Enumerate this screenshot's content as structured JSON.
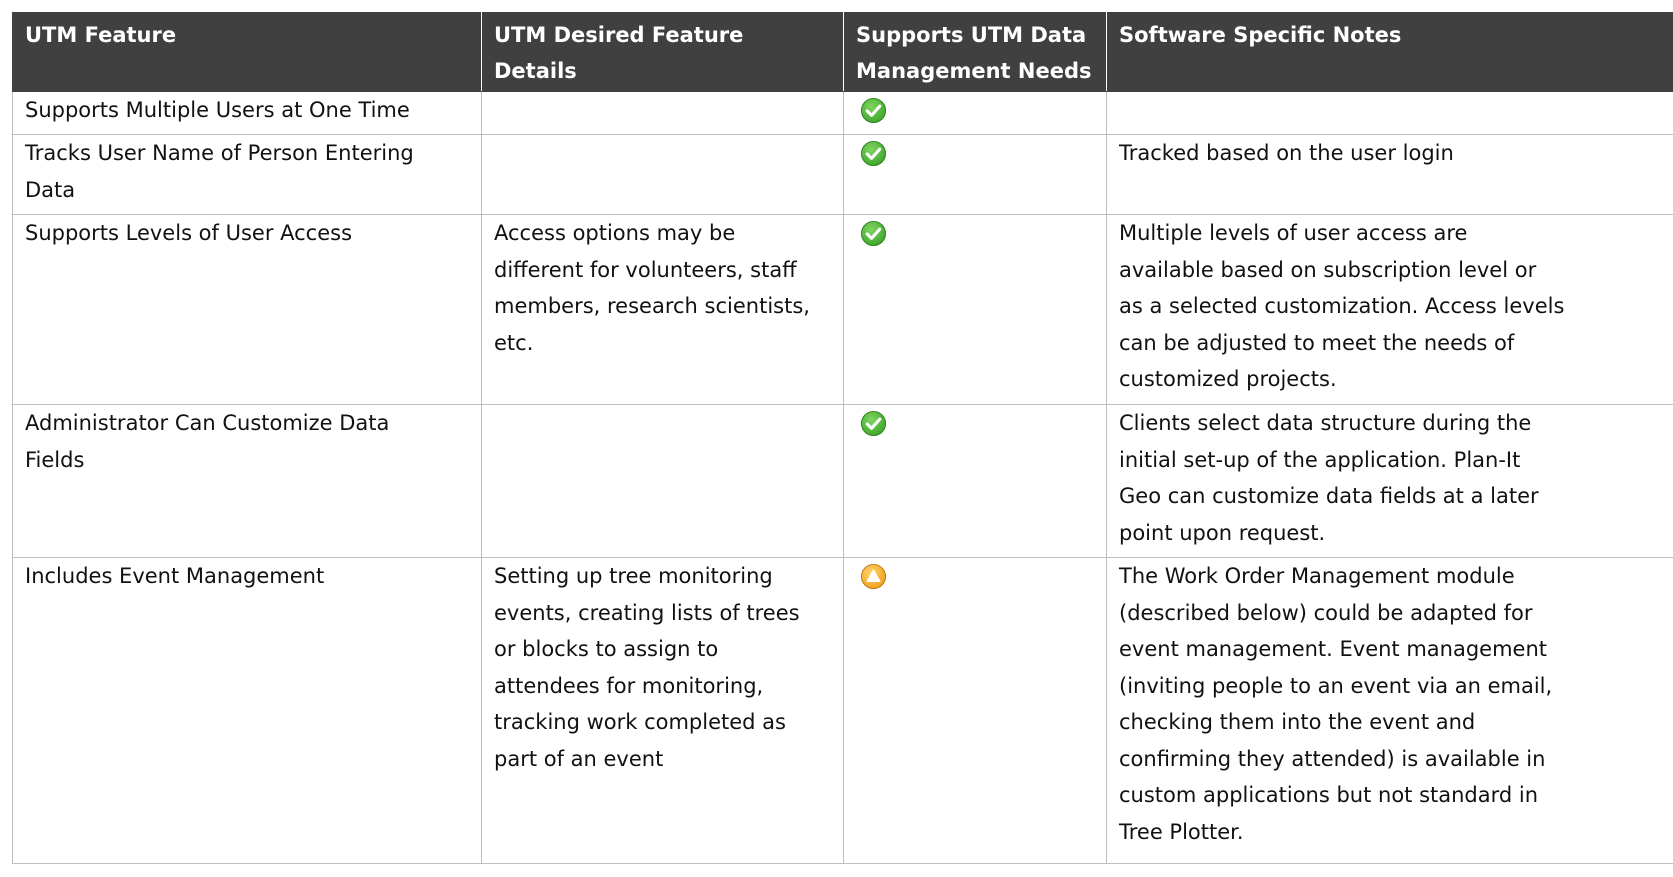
{
  "header": {
    "col1": [
      "UTM Feature"
    ],
    "col2": [
      "UTM Desired Feature Details"
    ],
    "col3": [
      "Supports UTM Data",
      "Management Needs"
    ],
    "col4": [
      "Software Specific Notes"
    ]
  },
  "rows": [
    {
      "feature": [
        "Supports Multiple Users at One Time"
      ],
      "details": [],
      "status": "supported",
      "notes": []
    },
    {
      "feature": [
        "Tracks User Name of Person Entering",
        "Data"
      ],
      "details": [],
      "status": "supported",
      "notes": [
        "Tracked based on the user login"
      ]
    },
    {
      "feature": [
        "Supports Levels of User Access"
      ],
      "details": [
        "Access options may be",
        "different for volunteers, staff",
        "members, research scientists,",
        "etc."
      ],
      "status": "supported",
      "notes": [
        "Multiple levels of user access are",
        "available based on subscription level or",
        "as a selected customization. Access levels",
        "can be adjusted to meet the needs of",
        "customized projects."
      ]
    },
    {
      "feature": [
        "Administrator Can Customize Data",
        "Fields"
      ],
      "details": [],
      "status": "supported",
      "notes": [
        "Clients select data structure during the",
        "initial set-up of the application. Plan-It",
        "Geo can customize data fields at a later",
        "point upon request."
      ]
    },
    {
      "feature": [
        "Includes Event Management"
      ],
      "details": [
        "Setting up tree monitoring",
        "events, creating lists of trees",
        "or blocks to assign to",
        "attendees for monitoring,",
        "tracking work completed as",
        "part of an event"
      ],
      "status": "partial",
      "notes": [
        "The Work Order Management module",
        "(described below) could be adapted for",
        "event management. Event management",
        "(inviting people to an event via an email,",
        "checking them into the event and",
        "confirming they attended) is available in",
        "custom applications but not standard in",
        "Tree Plotter."
      ]
    }
  ],
  "icons": {
    "supported": "green-check-icon",
    "partial": "orange-warning-icon"
  },
  "colors": {
    "header_bg": "#404040",
    "header_text": "#ffffff",
    "grid": "#bfbfbf",
    "check_green": "#3ea52a",
    "warning_orange": "#f0a01e"
  }
}
